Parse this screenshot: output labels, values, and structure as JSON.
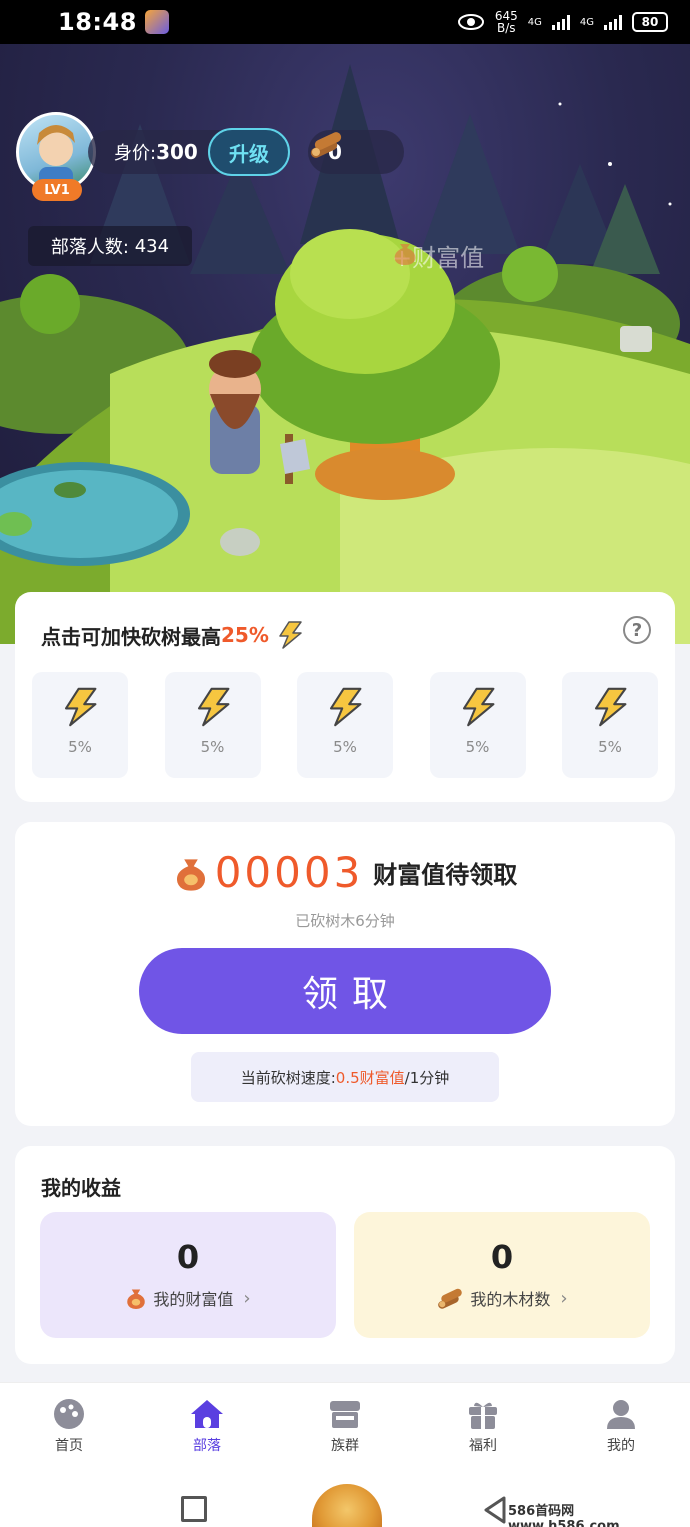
{
  "status_bar": {
    "time": "18:48",
    "net_speed_value": "645",
    "net_speed_unit": "B/s",
    "signal_1": "4G",
    "signal_2": "4G",
    "battery": "80"
  },
  "header": {
    "level": "LV1",
    "worth_label": "身价:",
    "worth_value": "300",
    "upgrade_label": "升级",
    "wood_count": "0",
    "tribe_label": "部落人数:",
    "tribe_count": "434",
    "wealth_float": "+财富值"
  },
  "speed_card": {
    "title_prefix": "点击可加快砍树最高",
    "title_pct": "25%",
    "help_symbol": "?",
    "boosts": [
      {
        "label": "5%"
      },
      {
        "label": "5%"
      },
      {
        "label": "5%"
      },
      {
        "label": "5%"
      },
      {
        "label": "5%"
      }
    ]
  },
  "claim_card": {
    "pending_value": "00003",
    "pending_label": "财富值待领取",
    "chopped_text": "已砍树木6分钟",
    "claim_button": "领取",
    "rate_prefix": "当前砍树速度:",
    "rate_value": "0.5财富值",
    "rate_suffix": "/1分钟"
  },
  "earnings": {
    "title": "我的收益",
    "wealth_value": "0",
    "wealth_label": "我的财富值",
    "wood_value": "0",
    "wood_label": "我的木材数"
  },
  "bottom_nav": [
    {
      "label": "首页",
      "icon": "home-planet-icon"
    },
    {
      "label": "部落",
      "icon": "house-icon"
    },
    {
      "label": "族群",
      "icon": "store-icon"
    },
    {
      "label": "福利",
      "icon": "gift-icon"
    },
    {
      "label": "我的",
      "icon": "user-icon"
    }
  ],
  "watermark": "586首码网 www.h586.com",
  "colors": {
    "accent": "#7055e6",
    "highlight": "#ef5a2b",
    "nav_active": "#5a3fe0"
  }
}
